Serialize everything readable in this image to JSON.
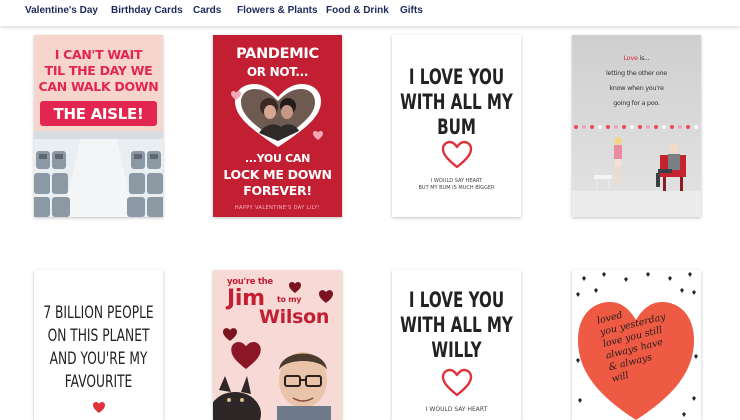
{
  "nav": {
    "items": [
      {
        "label": "Valentine's Day"
      },
      {
        "label": "Birthday Cards"
      },
      {
        "label": "Cards"
      },
      {
        "label": "Flowers & Plants"
      },
      {
        "label": "Food & Drink"
      },
      {
        "label": "Gifts"
      }
    ]
  },
  "cards": {
    "c1": {
      "lines": [
        "I CAN'T WAIT",
        "TIL THE DAY WE",
        "CAN WALK DOWN"
      ],
      "banner": "THE AISLE!"
    },
    "c2": {
      "top": [
        "PANDEMIC",
        "OR NOT..."
      ],
      "mid": [
        "...YOU CAN",
        "LOCK ME DOWN",
        "FOREVER!"
      ],
      "footer": "HAPPY VALENTINE'S DAY LILY!"
    },
    "c3": {
      "lines": [
        "I LOVE YOU",
        "WITH ALL MY",
        "BUM"
      ],
      "small": [
        "I WOULD SAY HEART",
        "BUT MY BUM IS MUCH BIGGER"
      ]
    },
    "c4": {
      "love": "Love",
      "is": " is...",
      "lines": [
        "letting the other one",
        "know when you're",
        "going for a poo."
      ]
    },
    "c5": {
      "lines": [
        "7 BILLION PEOPLE",
        "ON THIS PLANET",
        "AND YOU'RE MY",
        "FAVOURITE"
      ]
    },
    "c6": {
      "pre": "you're the",
      "jim": "Jim",
      "to_my": "to my",
      "wilson": "Wilson"
    },
    "c7": {
      "lines": [
        "I LOVE YOU",
        "WITH ALL MY",
        "WILLY"
      ],
      "small": [
        "I WOULD SAY HEART"
      ]
    },
    "c8": {
      "lines": [
        "loved",
        "you yesterday",
        "love you still",
        "always have",
        "& always",
        "will"
      ]
    }
  }
}
